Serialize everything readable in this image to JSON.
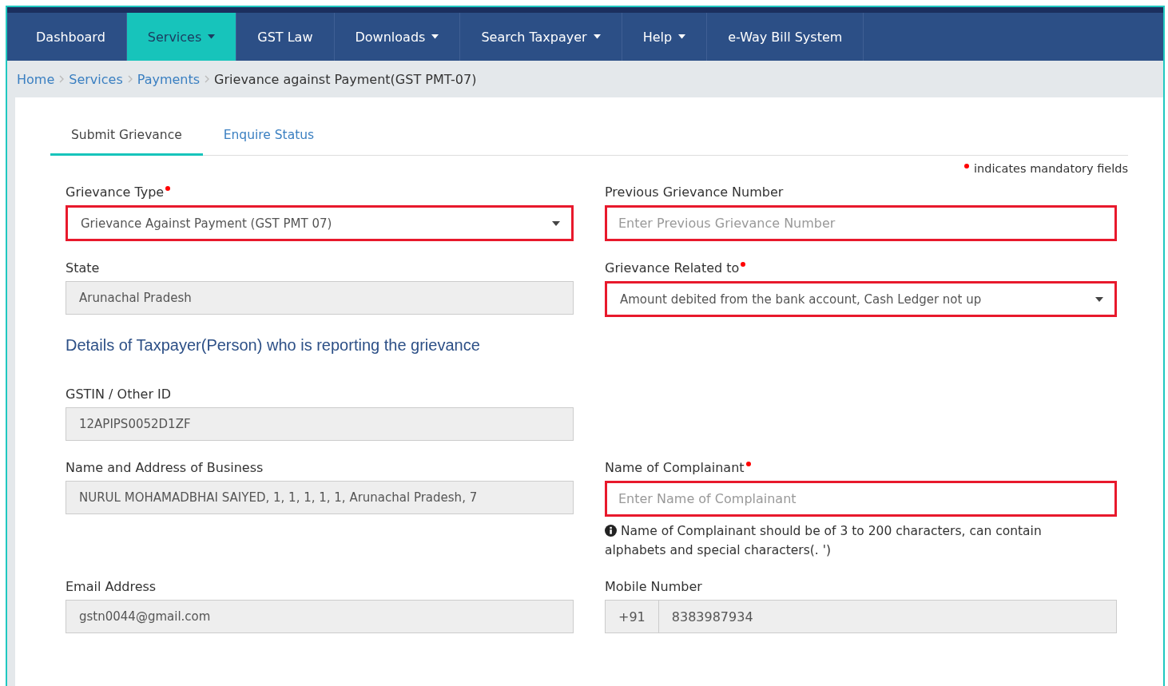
{
  "nav": [
    {
      "label": "Dashboard",
      "selected": false,
      "dropdown": false
    },
    {
      "label": "Services",
      "selected": true,
      "dropdown": true
    },
    {
      "label": "GST Law",
      "selected": false,
      "dropdown": false
    },
    {
      "label": "Downloads",
      "selected": false,
      "dropdown": true
    },
    {
      "label": "Search Taxpayer",
      "selected": false,
      "dropdown": true
    },
    {
      "label": "Help",
      "selected": false,
      "dropdown": true
    },
    {
      "label": "e-Way Bill System",
      "selected": false,
      "dropdown": false
    }
  ],
  "breadcrumb": [
    {
      "label": "Home",
      "current": false
    },
    {
      "label": "Services",
      "current": false
    },
    {
      "label": "Payments",
      "current": false
    },
    {
      "label": "Grievance against Payment(GST PMT-07)",
      "current": true
    }
  ],
  "tabs": [
    {
      "label": "Submit Grievance",
      "selected": true
    },
    {
      "label": "Enquire Status",
      "selected": false
    }
  ],
  "mandatory_note": "indicates mandatory fields",
  "rows": [
    {
      "kind": "fields",
      "left": {
        "kind": "select",
        "label": "Grievance Type",
        "required": true,
        "highlighted": true,
        "value": "Grievance Against Payment (GST PMT 07)"
      },
      "right": {
        "kind": "text",
        "label": "Previous Grievance Number",
        "required": false,
        "highlighted": true,
        "placeholder": "Enter Previous Grievance Number"
      }
    },
    {
      "kind": "fields",
      "left": {
        "kind": "readonly",
        "label": "State",
        "required": false,
        "highlighted": false,
        "value": "Arunachal Pradesh"
      },
      "right": {
        "kind": "select",
        "label": "Grievance Related to",
        "required": true,
        "highlighted": true,
        "value": "Amount debited from the bank account, Cash Ledger not up"
      }
    },
    {
      "kind": "heading",
      "text": "Details of Taxpayer(Person) who is reporting the grievance"
    },
    {
      "kind": "fields",
      "left": {
        "kind": "readonly",
        "label": "GSTIN / Other ID",
        "required": false,
        "highlighted": false,
        "value": "12APIPS0052D1ZF"
      }
    },
    {
      "kind": "fields",
      "left": {
        "kind": "readonly",
        "label": "Name and Address of Business",
        "required": false,
        "highlighted": false,
        "value": "NURUL MOHAMADBHAI SAIYED, 1, 1, 1, 1, 1, Arunachal Pradesh, 7"
      },
      "right": {
        "kind": "text",
        "label": "Name of Complainant",
        "required": true,
        "highlighted": true,
        "placeholder": "Enter Name of Complainant",
        "hint": "Name of Complainant should be of 3 to 200 characters, can contain alphabets and special characters(. ')"
      }
    },
    {
      "kind": "fields",
      "left": {
        "kind": "readonly",
        "label": "Email Address",
        "required": false,
        "highlighted": false,
        "value": "gstn0044@gmail.com"
      },
      "right": {
        "kind": "phone",
        "label": "Mobile Number",
        "required": false,
        "highlighted": false,
        "prefix": "+91",
        "value": "8383987934"
      }
    }
  ]
}
